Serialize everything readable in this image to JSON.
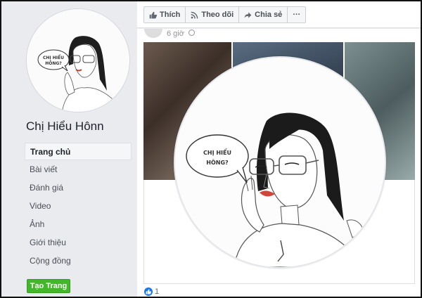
{
  "page": {
    "name": "Chị Hiểu Hônn"
  },
  "speech_bubble": {
    "line1": "CHỊ HIỂU",
    "line2": "HÔNG?"
  },
  "sidebar": {
    "items": [
      {
        "label": "Trang chủ",
        "active": true
      },
      {
        "label": "Bài viết"
      },
      {
        "label": "Đánh giá"
      },
      {
        "label": "Video"
      },
      {
        "label": "Ảnh"
      },
      {
        "label": "Giới thiệu"
      },
      {
        "label": "Cộng đồng"
      }
    ],
    "create_button": "Tạo Trang"
  },
  "actionbar": {
    "like": "Thích",
    "follow": "Theo dõi",
    "share": "Chia sẻ",
    "more": "···"
  },
  "post": {
    "time": "6 giờ",
    "reaction_count": "1"
  },
  "colors": {
    "accent": "#1877f2",
    "create_button": "#42b72a",
    "background": "#e9ebee"
  }
}
